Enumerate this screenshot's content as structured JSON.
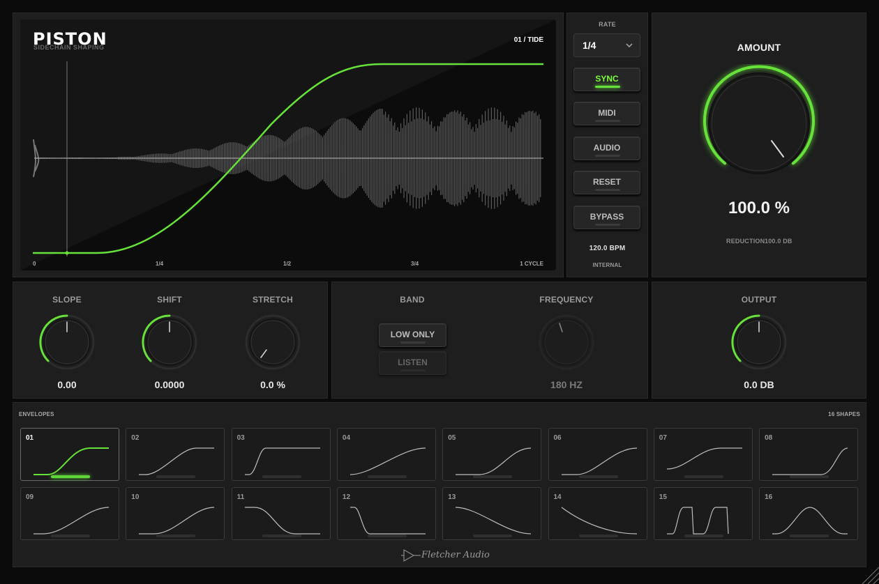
{
  "brand": {
    "name": "PISTON",
    "subtitle": "SIDECHAIN SHAPING",
    "footer_logo": "Fletcher Audio"
  },
  "display": {
    "preset": "01 / TIDE",
    "ticks": [
      "0",
      "1/4",
      "1/2",
      "3/4",
      "1 CYCLE"
    ]
  },
  "rate": {
    "label": "RATE",
    "value": "1/4"
  },
  "buttons": {
    "sync": "SYNC",
    "midi": "MIDI",
    "audio": "AUDIO",
    "reset": "RESET",
    "bypass": "BYPASS"
  },
  "tempo": {
    "bpm": "120.0 BPM",
    "source": "INTERNAL"
  },
  "amount": {
    "label": "AMOUNT",
    "value": "100.0 %",
    "reduction_label": "REDUCTION",
    "reduction_value": "100.0 DB",
    "level": 1.0
  },
  "knobs": {
    "slope": {
      "label": "SLOPE",
      "value": "0.00"
    },
    "shift": {
      "label": "SHIFT",
      "value": "0.0000"
    },
    "stretch": {
      "label": "STRETCH",
      "value": "0.0 %"
    },
    "frequency": {
      "label": "FREQUENCY",
      "value": "180 HZ"
    },
    "output": {
      "label": "OUTPUT",
      "value": "0.0 DB"
    }
  },
  "band": {
    "label": "BAND",
    "low_only": "LOW ONLY",
    "listen": "LISTEN"
  },
  "envelopes": {
    "label": "ENVELOPES",
    "count": "16 SHAPES",
    "selected": "01",
    "tiles": [
      "01",
      "02",
      "03",
      "04",
      "05",
      "06",
      "07",
      "08",
      "09",
      "10",
      "11",
      "12",
      "13",
      "14",
      "15",
      "16"
    ]
  },
  "colors": {
    "accent": "#67e23a",
    "panel": "#1e1e1e",
    "background": "#0b0b0b"
  }
}
